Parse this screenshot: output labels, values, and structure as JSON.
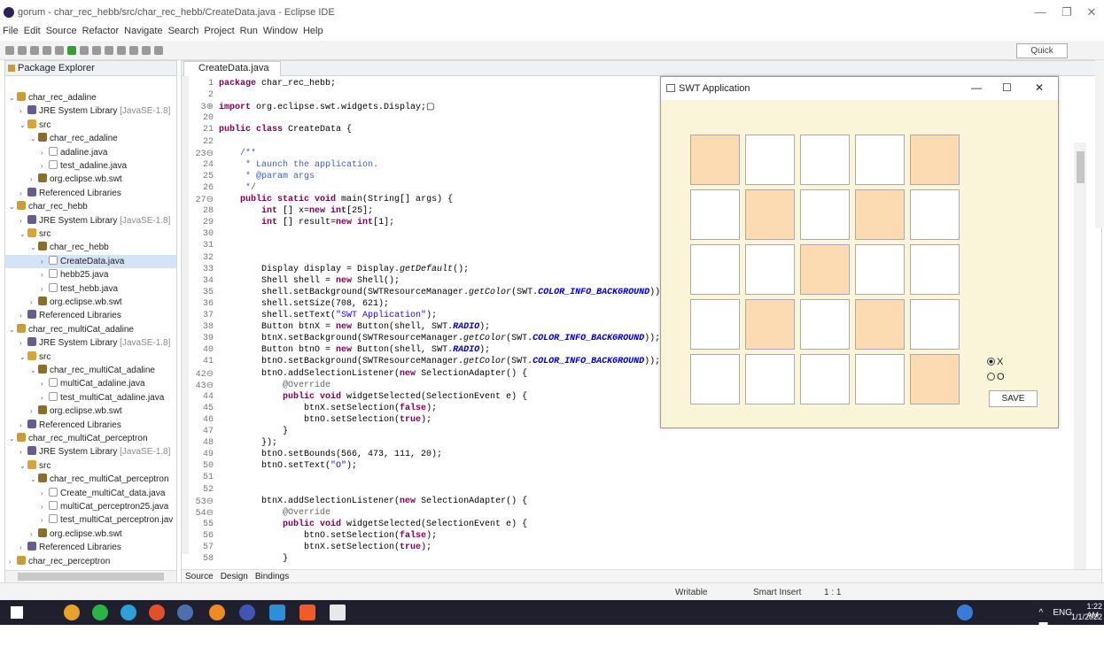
{
  "window": {
    "title": "gorum - char_rec_hebb/src/char_rec_hebb/CreateData.java - Eclipse IDE",
    "controls": [
      "—",
      "❐",
      "✕"
    ]
  },
  "menu": [
    "File",
    "Edit",
    "Source",
    "Refactor",
    "Navigate",
    "Search",
    "Project",
    "Run",
    "Window",
    "Help"
  ],
  "toolbar": {
    "quick_access": "Quick Access"
  },
  "package_explorer": {
    "title": "Package Explorer",
    "items": [
      {
        "label": "char_rec_adaline",
        "indent": 0,
        "icon": "project",
        "arrow": "v"
      },
      {
        "label": "JRE System Library",
        "suffix": "[JavaSE-1.8]",
        "indent": 1,
        "icon": "lib",
        "arrow": ">"
      },
      {
        "label": "src",
        "indent": 1,
        "icon": "src",
        "arrow": "v"
      },
      {
        "label": "char_rec_adaline",
        "indent": 2,
        "icon": "pkg",
        "arrow": "v"
      },
      {
        "label": "adaline.java",
        "indent": 3,
        "icon": "java",
        "arrow": ">"
      },
      {
        "label": "test_adaline.java",
        "indent": 3,
        "icon": "java",
        "arrow": ">"
      },
      {
        "label": "org.eclipse.wb.swt",
        "indent": 2,
        "icon": "pkg",
        "arrow": ">"
      },
      {
        "label": "Referenced Libraries",
        "indent": 1,
        "icon": "lib",
        "arrow": ">"
      },
      {
        "label": "char_rec_hebb",
        "indent": 0,
        "icon": "project",
        "arrow": "v"
      },
      {
        "label": "JRE System Library",
        "suffix": "[JavaSE-1.8]",
        "indent": 1,
        "icon": "lib",
        "arrow": ">"
      },
      {
        "label": "src",
        "indent": 1,
        "icon": "src",
        "arrow": "v"
      },
      {
        "label": "char_rec_hebb",
        "indent": 2,
        "icon": "pkg",
        "arrow": "v"
      },
      {
        "label": "CreateData.java",
        "indent": 3,
        "icon": "java",
        "arrow": ">",
        "selected": true
      },
      {
        "label": "hebb25.java",
        "indent": 3,
        "icon": "java",
        "arrow": ">"
      },
      {
        "label": "test_hebb.java",
        "indent": 3,
        "icon": "java",
        "arrow": ">"
      },
      {
        "label": "org.eclipse.wb.swt",
        "indent": 2,
        "icon": "pkg",
        "arrow": ">"
      },
      {
        "label": "Referenced Libraries",
        "indent": 1,
        "icon": "lib",
        "arrow": ">"
      },
      {
        "label": "char_rec_multiCat_adaline",
        "indent": 0,
        "icon": "project",
        "arrow": "v"
      },
      {
        "label": "JRE System Library",
        "suffix": "[JavaSE-1.8]",
        "indent": 1,
        "icon": "lib",
        "arrow": ">"
      },
      {
        "label": "src",
        "indent": 1,
        "icon": "src",
        "arrow": "v"
      },
      {
        "label": "char_rec_multiCat_adaline",
        "indent": 2,
        "icon": "pkg",
        "arrow": "v"
      },
      {
        "label": "multiCat_adaline.java",
        "indent": 3,
        "icon": "java",
        "arrow": ">"
      },
      {
        "label": "test_multiCat_adaline.java",
        "indent": 3,
        "icon": "java",
        "arrow": ">"
      },
      {
        "label": "org.eclipse.wb.swt",
        "indent": 2,
        "icon": "pkg",
        "arrow": ">"
      },
      {
        "label": "Referenced Libraries",
        "indent": 1,
        "icon": "lib",
        "arrow": ">"
      },
      {
        "label": "char_rec_multiCat_perceptron",
        "indent": 0,
        "icon": "project",
        "arrow": "v"
      },
      {
        "label": "JRE System Library",
        "suffix": "[JavaSE-1.8]",
        "indent": 1,
        "icon": "lib",
        "arrow": ">"
      },
      {
        "label": "src",
        "indent": 1,
        "icon": "src",
        "arrow": "v"
      },
      {
        "label": "char_rec_multiCat_perceptron",
        "indent": 2,
        "icon": "pkg",
        "arrow": "v"
      },
      {
        "label": "Create_multiCat_data.java",
        "indent": 3,
        "icon": "java",
        "arrow": ">"
      },
      {
        "label": "multiCat_perceptron25.java",
        "indent": 3,
        "icon": "java",
        "arrow": ">"
      },
      {
        "label": "test_multiCat_perceptron.jav",
        "indent": 3,
        "icon": "java",
        "arrow": ">"
      },
      {
        "label": "org.eclipse.wb.swt",
        "indent": 2,
        "icon": "pkg",
        "arrow": ">"
      },
      {
        "label": "Referenced Libraries",
        "indent": 1,
        "icon": "lib",
        "arrow": ">"
      },
      {
        "label": "char_rec_perceptron",
        "indent": 0,
        "icon": "project",
        "arrow": ">"
      }
    ]
  },
  "editor": {
    "tab": "CreateData.java",
    "lines": [
      {
        "n": "1",
        "html": "<span class='kw'>package</span> char_rec_hebb;"
      },
      {
        "n": "2",
        "html": ""
      },
      {
        "n": "3⊕",
        "html": "<span class='kw'>import</span> org.eclipse.swt.widgets.Display;▢"
      },
      {
        "n": "20",
        "html": ""
      },
      {
        "n": "21",
        "html": "<span class='kw'>public class</span> CreateData {"
      },
      {
        "n": "22",
        "html": ""
      },
      {
        "n": "23⊖",
        "html": "    <span class='cm'>/**</span>"
      },
      {
        "n": "24",
        "html": "<span class='cm'>     * Launch the application.</span>"
      },
      {
        "n": "25",
        "html": "<span class='cm'>     * @param args</span>"
      },
      {
        "n": "26",
        "html": "<span class='cm'>     */</span>"
      },
      {
        "n": "27⊖",
        "html": "    <span class='kw'>public static void</span> main(String[] args) {"
      },
      {
        "n": "28",
        "html": "        <span class='kw'>int</span> [] x=<span class='kw'>new int</span>[25];"
      },
      {
        "n": "29",
        "html": "        <span class='kw'>int</span> [] result=<span class='kw'>new int</span>[1];"
      },
      {
        "n": "30",
        "html": ""
      },
      {
        "n": "31",
        "html": ""
      },
      {
        "n": "32",
        "html": ""
      },
      {
        "n": "33",
        "html": "        Display display = Display.<span class='it'>getDefault</span>();"
      },
      {
        "n": "34",
        "html": "        Shell shell = <span class='kw'>new</span> Shell();"
      },
      {
        "n": "35",
        "html": "        shell.setBackground(SWTResourceManager.<span class='it'>getColor</span>(SWT.<span class='fd'>COLOR_INFO_BACKGROUND</span>));"
      },
      {
        "n": "36",
        "html": "        shell.setSize(708, 621);"
      },
      {
        "n": "37",
        "html": "        shell.setText(<span class='st'>\"SWT Application\"</span>);"
      },
      {
        "n": "38",
        "html": "        Button btnX = <span class='kw'>new</span> Button(shell, SWT.<span class='fd'>RADIO</span>);"
      },
      {
        "n": "39",
        "html": "        btnX.setBackground(SWTResourceManager.<span class='it'>getColor</span>(SWT.<span class='fd'>COLOR_INFO_BACKGROUND</span>));"
      },
      {
        "n": "40",
        "html": "        Button btnO = <span class='kw'>new</span> Button(shell, SWT.<span class='fd'>RADIO</span>);"
      },
      {
        "n": "41",
        "html": "        btnO.setBackground(SWTResourceManager.<span class='it'>getColor</span>(SWT.<span class='fd'>COLOR_INFO_BACKGROUND</span>));"
      },
      {
        "n": "42⊖",
        "html": "        btnO.addSelectionListener(<span class='kw'>new</span> SelectionAdapter() {"
      },
      {
        "n": "43⊖",
        "html": "            <span class='an'>@Override</span>"
      },
      {
        "n": "44",
        "html": "            <span class='kw'>public void</span> widgetSelected(SelectionEvent e) {"
      },
      {
        "n": "45",
        "html": "                btnX.setSelection(<span class='kw'>false</span>);"
      },
      {
        "n": "46",
        "html": "                btnO.setSelection(<span class='kw'>true</span>);"
      },
      {
        "n": "47",
        "html": "            }"
      },
      {
        "n": "48",
        "html": "        });"
      },
      {
        "n": "49",
        "html": "        btnO.setBounds(566, 473, 111, 20);"
      },
      {
        "n": "50",
        "html": "        btnO.setText(<span class='st'>\"O\"</span>);"
      },
      {
        "n": "51",
        "html": ""
      },
      {
        "n": "52",
        "html": ""
      },
      {
        "n": "53⊖",
        "html": "        btnX.addSelectionListener(<span class='kw'>new</span> SelectionAdapter() {"
      },
      {
        "n": "54⊖",
        "html": "            <span class='an'>@Override</span>"
      },
      {
        "n": "55",
        "html": "            <span class='kw'>public void</span> widgetSelected(SelectionEvent e) {"
      },
      {
        "n": "56",
        "html": "                btnO.setSelection(<span class='kw'>false</span>);"
      },
      {
        "n": "57",
        "html": "                btnX.setSelection(<span class='kw'>true</span>);"
      },
      {
        "n": "58",
        "html": "            }"
      }
    ],
    "bottom_tabs": [
      "Source",
      "Design",
      "Bindings"
    ]
  },
  "swt_app": {
    "title": "SWT Application",
    "controls": [
      "—",
      "☐",
      "✕"
    ],
    "grid": [
      [
        1,
        0,
        0,
        0,
        1
      ],
      [
        0,
        1,
        0,
        1,
        0
      ],
      [
        0,
        0,
        1,
        0,
        0
      ],
      [
        0,
        1,
        0,
        1,
        0
      ],
      [
        0,
        0,
        0,
        0,
        1
      ]
    ],
    "radio_x": "X",
    "radio_o": "O",
    "save": "SAVE"
  },
  "status": {
    "writable": "Writable",
    "insert": "Smart Insert",
    "pos": "1 : 1"
  },
  "taskbar": {
    "lang": "ENG",
    "time": "1:22 AM",
    "date": "1/1/2022"
  }
}
